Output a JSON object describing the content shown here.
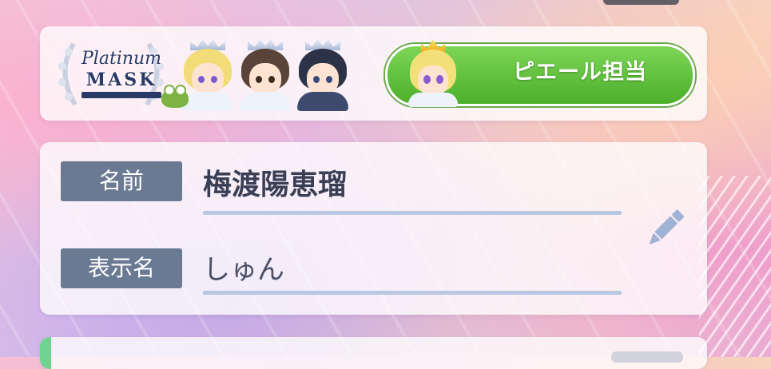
{
  "unit_banner": {
    "logo_line1": "Platinum",
    "logo_line2": "MASK"
  },
  "oshi_badge": {
    "label": "ピエール担当"
  },
  "profile": {
    "name_label": "名前",
    "name_value": "梅渡陽恵瑠",
    "display_label": "表示名",
    "display_value": "しゅん"
  },
  "colors": {
    "badge_green": "#5cc23a",
    "tag_bg": "#6b7a93",
    "underline": "#b9c7e2",
    "pencil": "#9fb3d6",
    "accent_green": "#6fd48f"
  }
}
